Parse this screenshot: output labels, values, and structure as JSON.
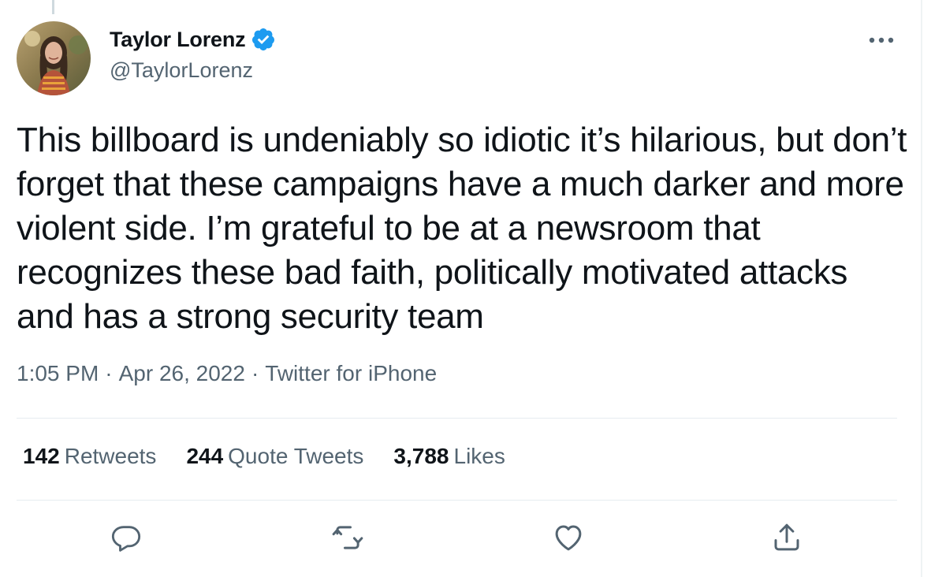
{
  "tweet": {
    "author": {
      "display_name": "Taylor Lorenz",
      "handle": "@TaylorLorenz",
      "verified": true
    },
    "text": "This billboard is undeniably so idiotic it’s hilarious, but don’t forget that these campaigns have a much darker and more violent side. I’m grateful to be at a newsroom that recognizes these bad faith, politically motivated attacks and has a strong security team",
    "meta": {
      "time": "1:05 PM",
      "date": "Apr 26, 2022",
      "source": "Twitter for iPhone",
      "separator": "·"
    },
    "stats": {
      "retweets": {
        "count": "142",
        "label": "Retweets"
      },
      "quote_tweets": {
        "count": "244",
        "label": "Quote Tweets"
      },
      "likes": {
        "count": "3,788",
        "label": "Likes"
      }
    },
    "actions": [
      "reply-icon",
      "retweet-icon",
      "like-icon",
      "share-icon"
    ]
  },
  "colors": {
    "text_primary": "#0f1419",
    "text_secondary": "#536471",
    "verified_blue": "#1d9bf0",
    "divider": "#e6ecf0",
    "action_icon": "#536471"
  }
}
